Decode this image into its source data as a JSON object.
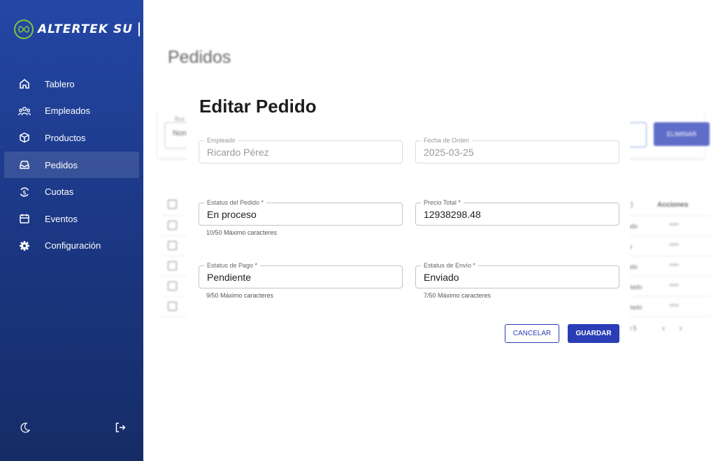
{
  "brand": {
    "name": "ALTERTEK SU",
    "accent": "#7ec63f"
  },
  "sidebar": {
    "items": [
      {
        "label": "Tablero",
        "icon": "home-icon"
      },
      {
        "label": "Empleados",
        "icon": "users-icon"
      },
      {
        "label": "Productos",
        "icon": "box-icon"
      },
      {
        "label": "Pedidos",
        "icon": "inbox-icon",
        "active": true
      },
      {
        "label": "Cuotas",
        "icon": "dollar-refresh-icon"
      },
      {
        "label": "Eventos",
        "icon": "calendar-icon"
      },
      {
        "label": "Configuración",
        "icon": "gear-icon"
      }
    ],
    "bottom": {
      "theme_icon": "moon-icon",
      "logout_icon": "logout-icon"
    }
  },
  "page": {
    "title": "Pedidos",
    "search_label": "Bus",
    "search_value": "Non",
    "delete_label": "ELIMINAR",
    "actions_header": "Acciones",
    "row_fragments": [
      "ado",
      "lo",
      "ado",
      "viado",
      "viado"
    ],
    "pager_text": "e 5"
  },
  "modal": {
    "title": "Editar Pedido",
    "fields": {
      "empleado": {
        "label": "Empleado",
        "value": "Ricardo Pérez"
      },
      "fecha": {
        "label": "Fecha de Orden",
        "value": "2025-03-25"
      },
      "estatus_pedido": {
        "label": "Estatus del Pedido *",
        "value": "En proceso",
        "helper": "10/50 Máximo caracteres"
      },
      "precio": {
        "label": "Precio Total *",
        "value": "12938298.48"
      },
      "estatus_pago": {
        "label": "Estatus de Pago *",
        "value": "Pendiente",
        "helper": "9/50 Máximo caracteres"
      },
      "estatus_envio": {
        "label": "Estatus de Envío *",
        "value": "Enviado",
        "helper": "7/50 Máximo caracteres"
      }
    },
    "cancel_label": "CANCELAR",
    "save_label": "GUARDAR"
  },
  "colors": {
    "primary": "#2b3db6",
    "sidebar": "#1d3a8a"
  }
}
